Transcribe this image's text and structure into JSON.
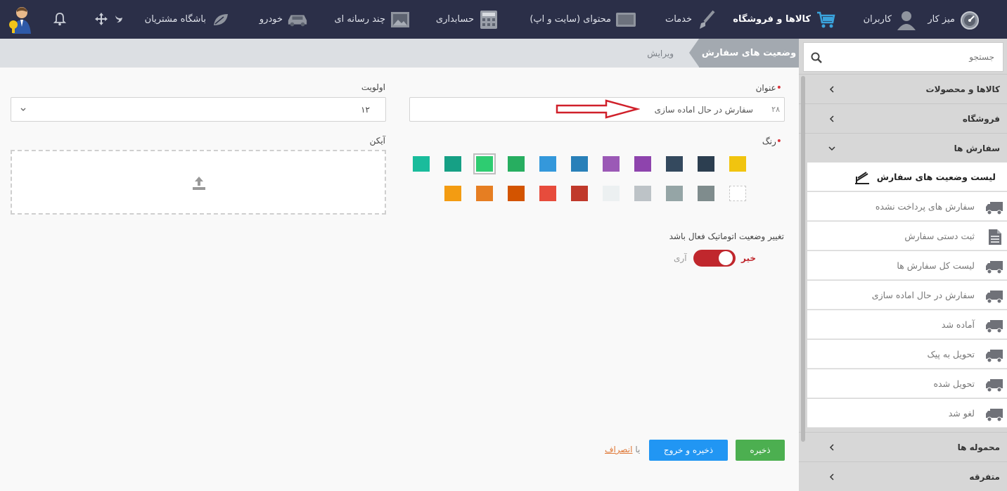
{
  "topbar": {
    "items": [
      {
        "label": "میز کار",
        "icon": "dashboard-gauge-icon"
      },
      {
        "label": "کاربران",
        "icon": "user-icon"
      },
      {
        "label": "کالاها و فروشگاه",
        "icon": "shopping-cart-icon",
        "active": true
      },
      {
        "label": "خدمات",
        "icon": "brush-icon"
      },
      {
        "label": "محتوای (سایت و اپ)",
        "icon": "folder-icon"
      },
      {
        "label": "حسابداری",
        "icon": "calculator-icon"
      },
      {
        "label": "چند رسانه ای",
        "icon": "image-icon"
      },
      {
        "label": "خودرو",
        "icon": "car-icon"
      },
      {
        "label": "باشگاه مشتریان",
        "icon": "leaf-icon"
      }
    ]
  },
  "breadcrumb": {
    "current": "وضعیت های سفارش",
    "action": "ویرایش"
  },
  "sidebar": {
    "search_placeholder": "جستجو",
    "groups": [
      {
        "label": "کالاها و محصولات"
      },
      {
        "label": "فروشگاه"
      },
      {
        "label": "سفارش ها",
        "expanded": true
      }
    ],
    "sub_items": [
      {
        "label": "لیست وضعیت های سفارش",
        "icon": "stack-icon",
        "active": true
      },
      {
        "label": "سفارش های پرداخت نشده",
        "icon": "truck-icon"
      },
      {
        "label": "ثبت دستی سفارش",
        "icon": "document-icon"
      },
      {
        "label": "لیست کل سفارش ها",
        "icon": "truck-icon"
      },
      {
        "label": "سفارش در حال اماده سازی",
        "icon": "truck-icon"
      },
      {
        "label": "آماده شد",
        "icon": "truck-icon"
      },
      {
        "label": "تحویل به پیک",
        "icon": "truck-icon"
      },
      {
        "label": "تحویل شده",
        "icon": "truck-icon"
      },
      {
        "label": "لغو شد",
        "icon": "truck-icon"
      }
    ],
    "groups_after": [
      {
        "label": "محموله ها"
      },
      {
        "label": "متفرقه"
      }
    ]
  },
  "form": {
    "title_label": "عنوان",
    "title_value": "سفارش در حال اماده سازی",
    "title_count": "۲۸",
    "priority_label": "اولویت",
    "priority_value": "۱۲",
    "color_label": "رنگ",
    "colors_row1": [
      "#f1c40f",
      "#2c3e50",
      "#34495e",
      "#8e44ad",
      "#9b59b6",
      "#2980b9",
      "#3498db",
      "#27ae60",
      "#2ecc71",
      "#16a085",
      "#1abc9c"
    ],
    "colors_row2": [
      "",
      "#7f8c8d",
      "#95a5a6",
      "#bdc3c7",
      "#ecf0f1",
      "#c0392b",
      "#e74c3c",
      "#d35400",
      "#e67e22",
      "#f39c12"
    ],
    "selected_color": "#2ecc71",
    "icon_label": "آیکن",
    "auto_status_label": "تغییر وضعیت اتوماتیک فعال باشد",
    "toggle_no": "خیر",
    "toggle_yes": "آری",
    "toggle_state": "no",
    "save_label": "ذخیره",
    "save_exit_label": "ذخیره و خروج",
    "or_text": "یا",
    "cancel_label": "انصراف"
  }
}
